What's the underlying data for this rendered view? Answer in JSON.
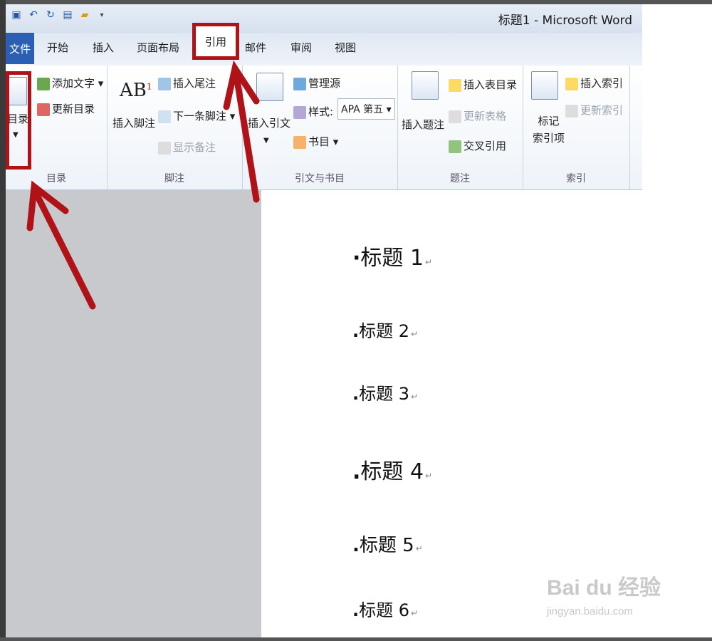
{
  "window": {
    "title": "标题1 - Microsoft Word"
  },
  "qat": {
    "icons": [
      "save-icon",
      "undo-icon",
      "redo-icon",
      "new-doc-icon",
      "open-icon",
      "customize-icon"
    ]
  },
  "tabs": {
    "file": "文件",
    "home": "开始",
    "insert": "插入",
    "layout": "页面布局",
    "references": "引用",
    "mailings": "邮件",
    "review": "审阅",
    "view": "视图"
  },
  "ribbon": {
    "toc": {
      "button": "目录",
      "add_text": "添加文字",
      "update": "更新目录",
      "group": "目录"
    },
    "footnotes": {
      "insert_footnote": "插入脚注",
      "insert_endnote": "插入尾注",
      "next_footnote": "下一条脚注",
      "show_notes": "显示备注",
      "group": "脚注"
    },
    "citations": {
      "insert_citation": "插入引文",
      "manage_sources": "管理源",
      "style_label": "样式:",
      "style_value": "APA 第五",
      "bibliography": "书目",
      "group": "引文与书目"
    },
    "captions": {
      "insert_caption": "插入题注",
      "insert_table_of_figures": "插入表目录",
      "update_table": "更新表格",
      "cross_reference": "交叉引用",
      "group": "题注"
    },
    "index": {
      "mark_entry": "标记\n索引项",
      "mark_entry_l1": "标记",
      "mark_entry_l2": "索引项",
      "insert_index": "插入索引",
      "update_index": "更新索引",
      "group": "索引"
    }
  },
  "document": {
    "headings": [
      "标题 1",
      "标题 2",
      "标题 3",
      "标题 4",
      "标题 5",
      "标题 6"
    ]
  },
  "watermark": {
    "logo": "Bai du 经验",
    "url": "jingyan.baidu.com"
  },
  "colors": {
    "highlight": "#b01317",
    "file_tab": "#2b5fb3"
  }
}
